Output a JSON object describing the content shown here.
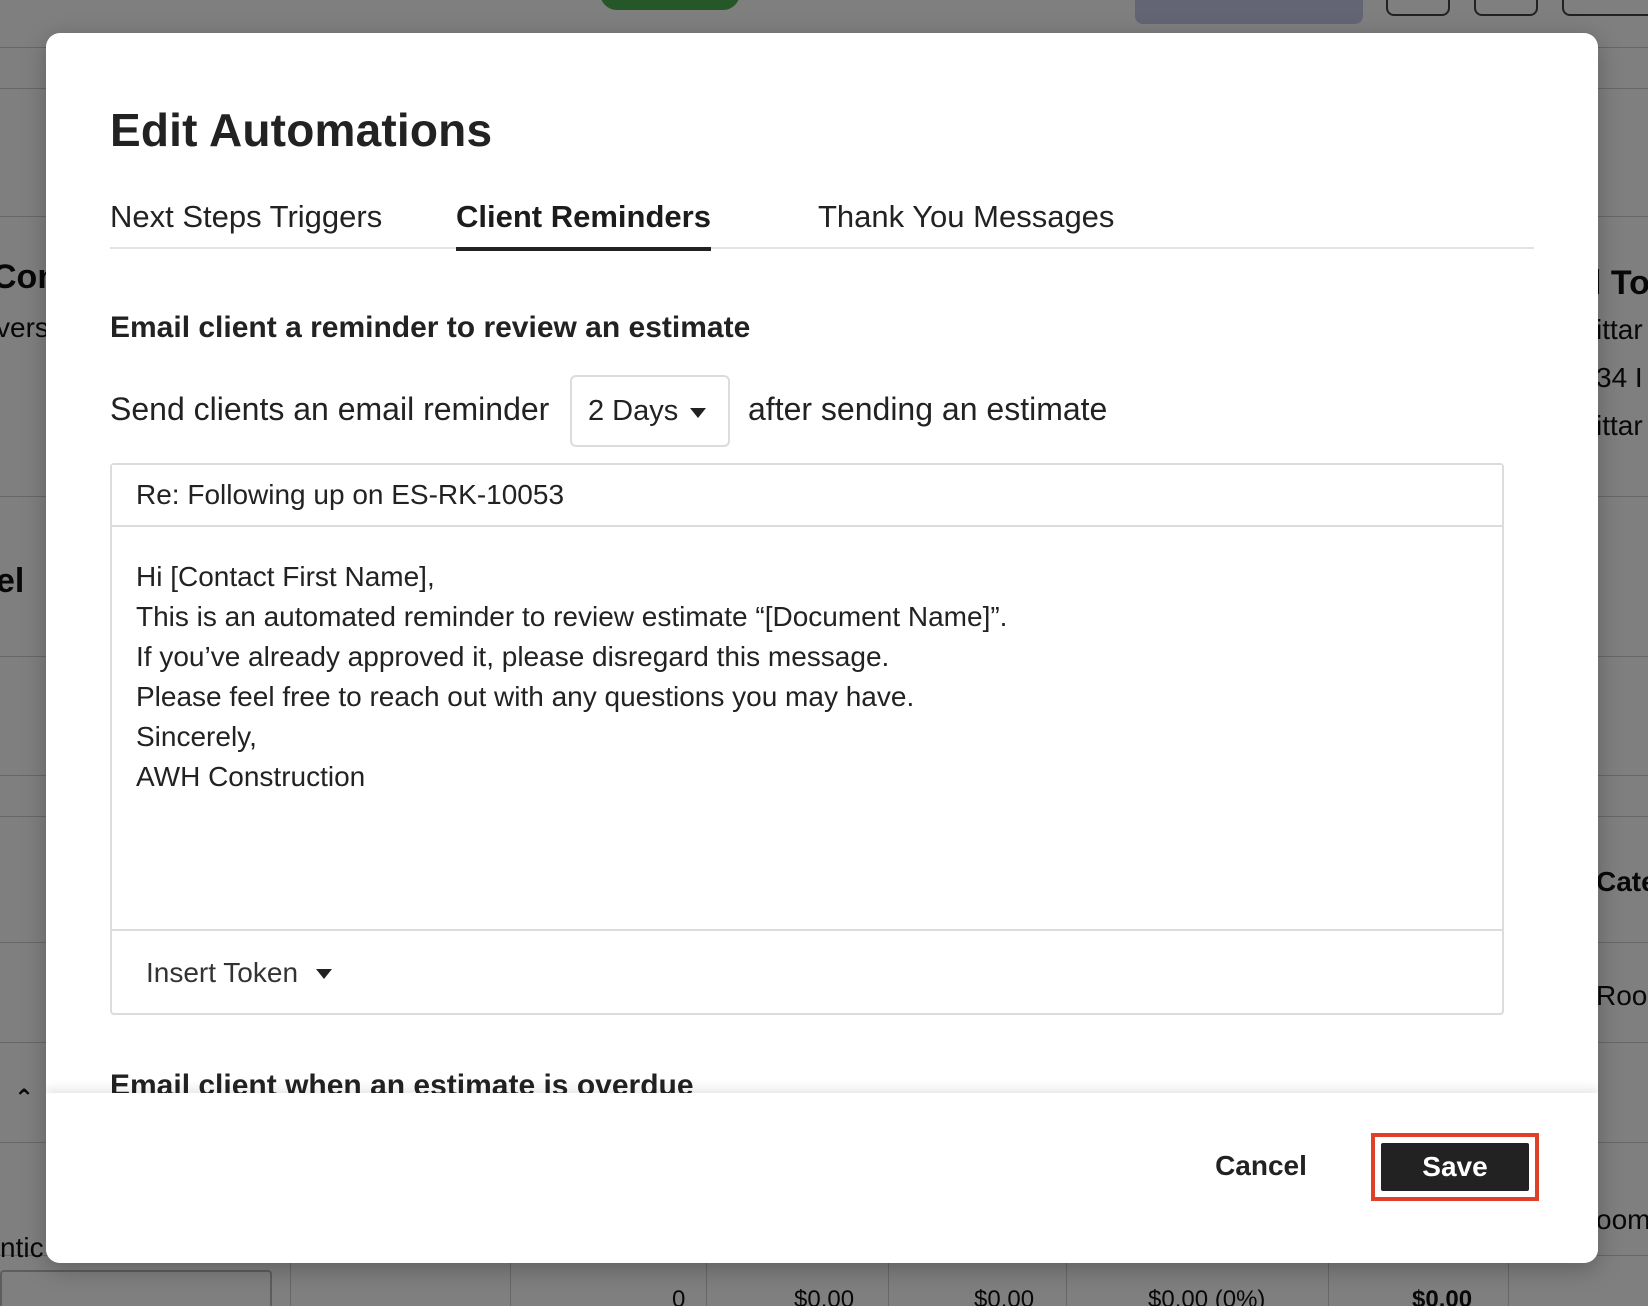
{
  "background": {
    "text_fragments": [
      "Con",
      "vers",
      "el",
      "l To",
      "ittar",
      "34 I",
      "ittar",
      "Cate",
      "Roo.",
      "oom",
      "ntic"
    ],
    "row_values": [
      "0",
      "$0.00",
      "$0.00",
      "$0.00 (0%)",
      "$0.00"
    ]
  },
  "modal": {
    "title": "Edit Automations",
    "tabs": [
      {
        "label": "Next Steps Triggers"
      },
      {
        "label": "Client Reminders"
      },
      {
        "label": "Thank You Messages"
      }
    ],
    "active_tab": "Client Reminders",
    "sections": [
      {
        "heading": "Email client a reminder to review an estimate",
        "prefix_text": "Send clients an email reminder",
        "delay_value": "2 Days",
        "suffix_text": "after sending an estimate",
        "subject": "Re: Following up on ES-RK-10053",
        "body_lines": [
          "Hi [Contact First Name],",
          "This is an automated reminder to review estimate “[Document Name]”.",
          "If you’ve already approved it, please disregard this message.",
          "Please feel free to reach out with any questions you may have.",
          "Sincerely,",
          "AWH Construction"
        ],
        "insert_token_label": "Insert Token"
      },
      {
        "heading": "Email client when an estimate is overdue"
      }
    ],
    "footer": {
      "cancel_label": "Cancel",
      "save_label": "Save",
      "save_highlight_color": "#e0402a"
    }
  }
}
